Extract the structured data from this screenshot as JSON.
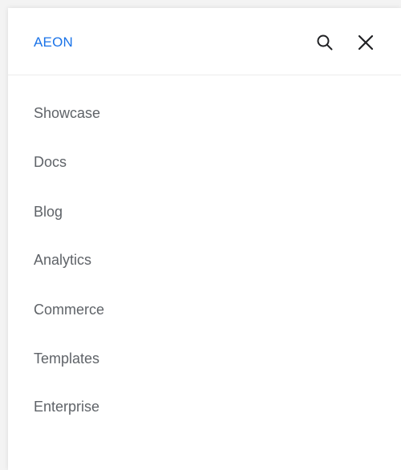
{
  "header": {
    "brand": "AEON",
    "search_icon": "search-icon",
    "close_icon": "close-icon"
  },
  "nav": {
    "items": [
      {
        "label": "Showcase"
      },
      {
        "label": "Docs"
      },
      {
        "label": "Blog"
      },
      {
        "label": "Analytics"
      },
      {
        "label": "Commerce"
      },
      {
        "label": "Templates"
      },
      {
        "label": "Enterprise"
      }
    ]
  },
  "colors": {
    "brand": "#1a73e8",
    "nav_text": "#5f6368",
    "icon": "#202124",
    "divider": "#ececec"
  }
}
